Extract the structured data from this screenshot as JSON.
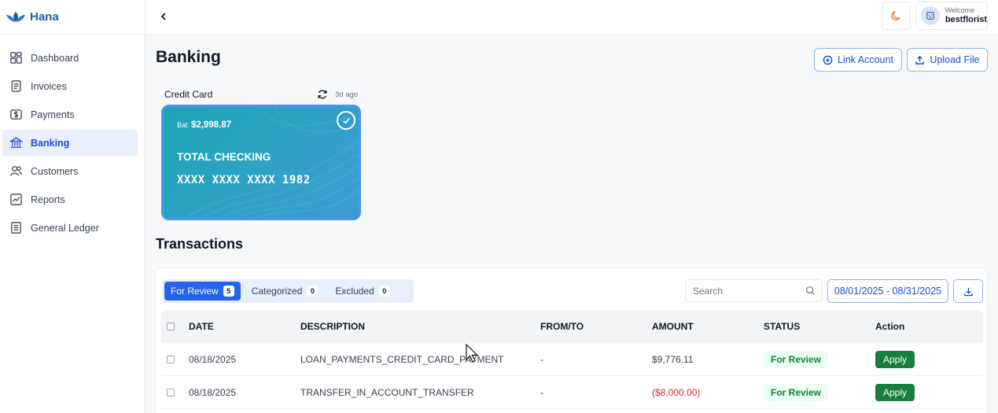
{
  "app": {
    "name": "Hana",
    "brand_color": "#1f5fa8"
  },
  "sidebar": {
    "items": [
      {
        "label": "Dashboard",
        "icon": "dashboard-icon",
        "active": false
      },
      {
        "label": "Invoices",
        "icon": "invoice-icon",
        "active": false
      },
      {
        "label": "Payments",
        "icon": "dollar-icon",
        "active": false
      },
      {
        "label": "Banking",
        "icon": "bank-icon",
        "active": true
      },
      {
        "label": "Customers",
        "icon": "users-icon",
        "active": false
      },
      {
        "label": "Reports",
        "icon": "chart-line-icon",
        "active": false
      },
      {
        "label": "General Ledger",
        "icon": "ledger-icon",
        "active": false
      }
    ]
  },
  "topbar": {
    "back_icon": "chevron-left-icon",
    "theme_icon": "moon-icon",
    "welcome": "Welcome",
    "username": "bestflorist"
  },
  "page": {
    "title": "Banking",
    "link_account": "Link Account",
    "upload_file": "Upload File"
  },
  "account": {
    "label": "Credit Card",
    "synced": "3d ago",
    "balance_prefix": "Bal:",
    "balance": "$2,998.87",
    "name": "TOTAL CHECKING",
    "number": "XXXX XXXX XXXX 1982",
    "selected": true
  },
  "transactions": {
    "title": "Transactions",
    "tabs": [
      {
        "label": "For Review",
        "count": "5",
        "active": true
      },
      {
        "label": "Categorized",
        "count": "0",
        "active": false
      },
      {
        "label": "Excluded",
        "count": "0",
        "active": false
      }
    ],
    "search_placeholder": "Search",
    "date_range": "08/01/2025 - 08/31/2025",
    "columns": [
      "DATE",
      "DESCRIPTION",
      "FROM/TO",
      "AMOUNT",
      "STATUS",
      "Action"
    ],
    "rows": [
      {
        "date": "08/18/2025",
        "description": "LOAN_PAYMENTS_CREDIT_CARD_PAYMENT",
        "from_to": "-",
        "amount": "$9,776.11",
        "status": "For Review",
        "action": "Apply"
      },
      {
        "date": "08/18/2025",
        "description": "TRANSFER_IN_ACCOUNT_TRANSFER",
        "from_to": "-",
        "amount": "($8,000.00)",
        "status": "For Review",
        "action": "Apply"
      }
    ]
  }
}
